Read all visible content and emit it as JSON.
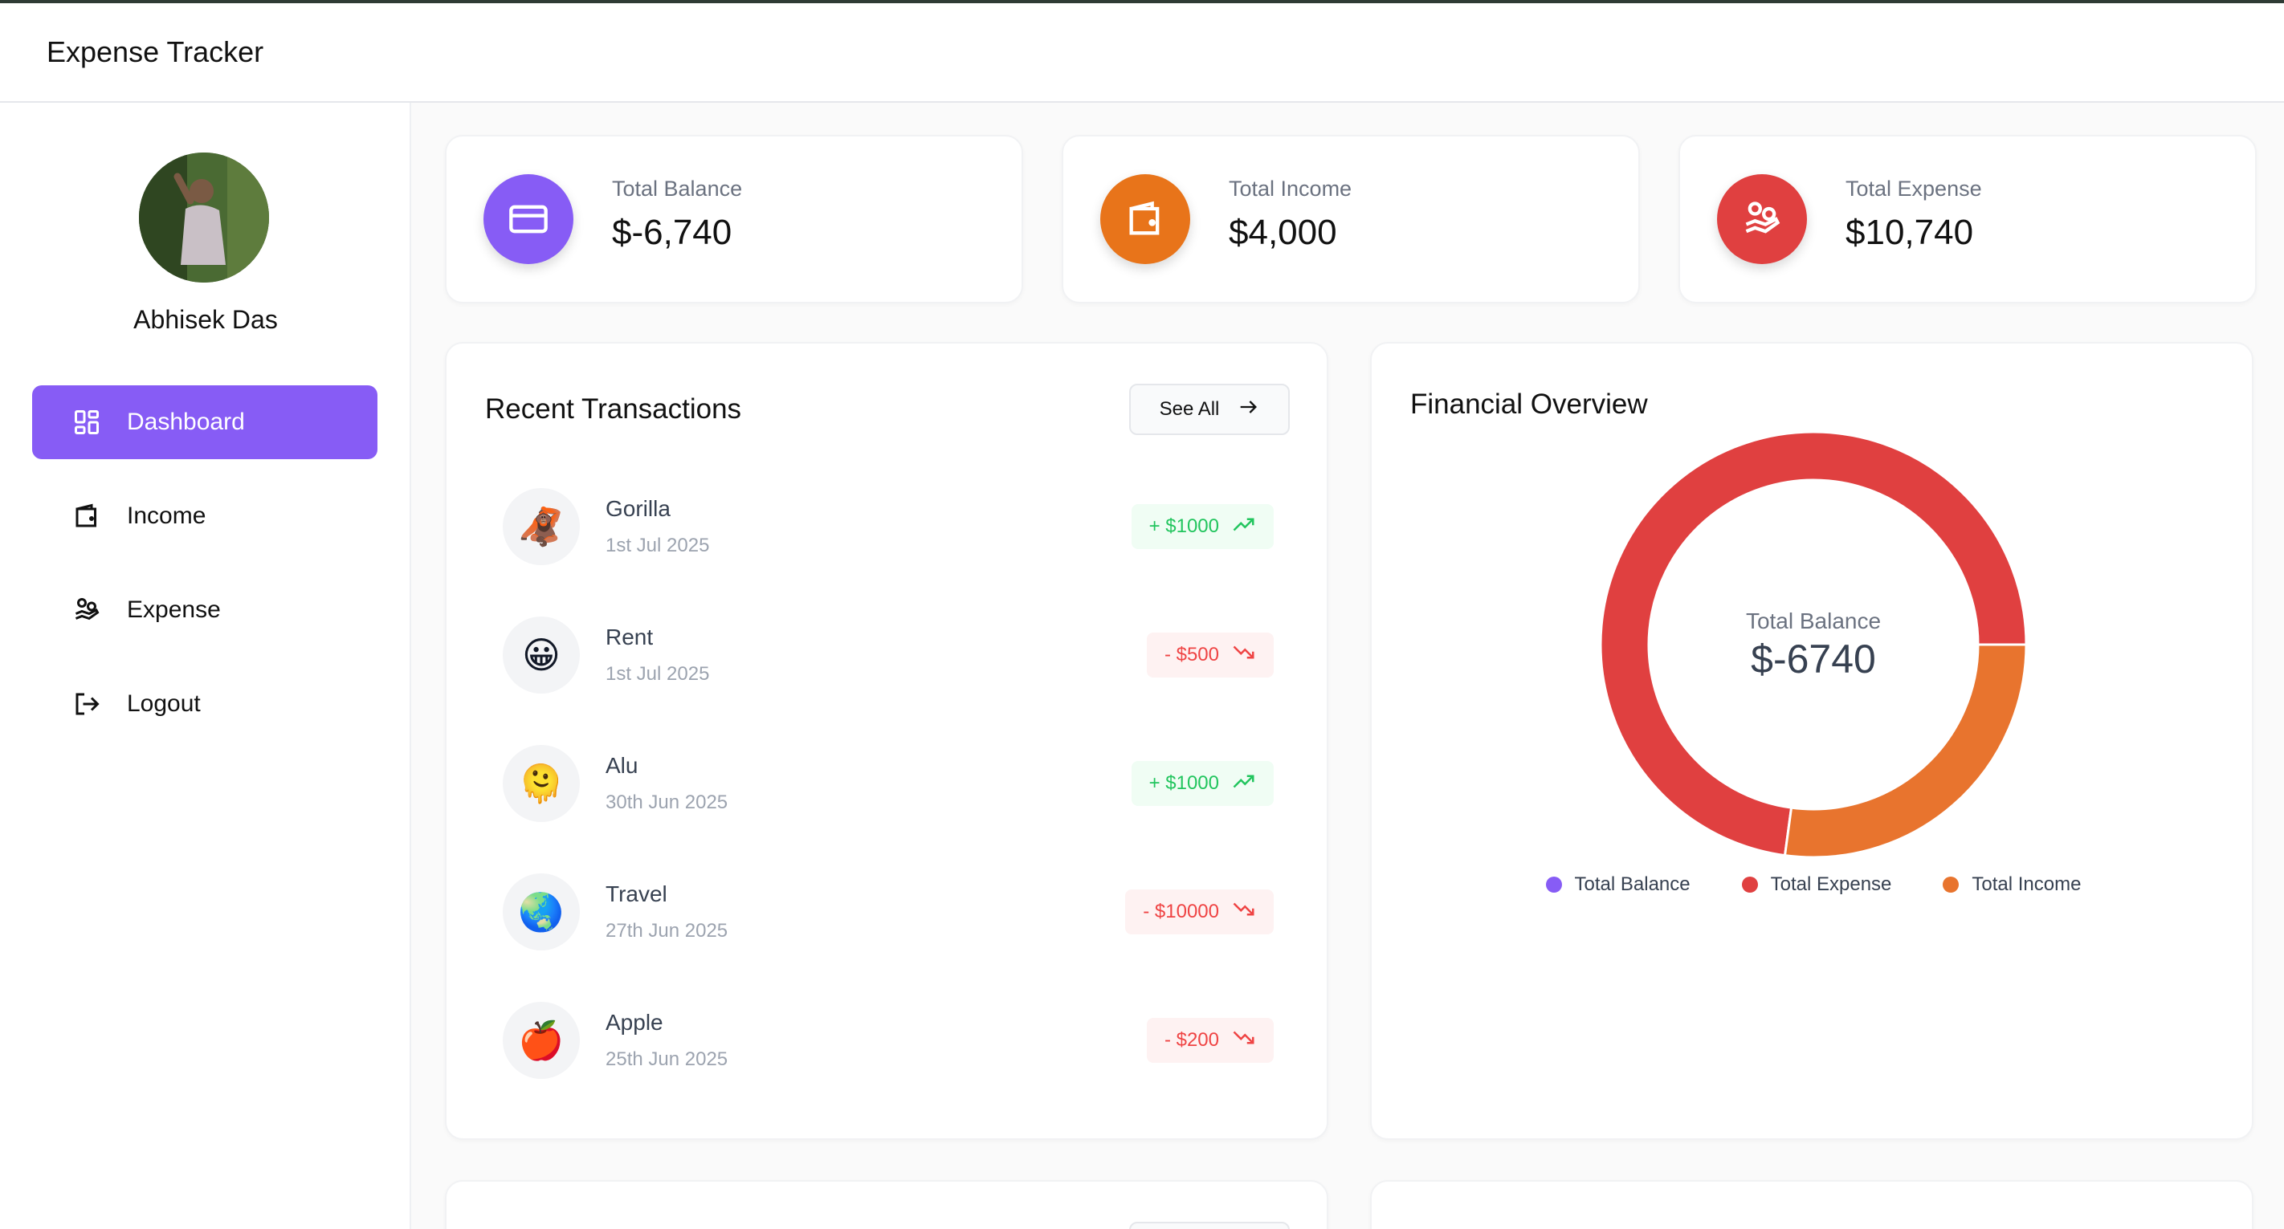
{
  "app": {
    "title": "Expense Tracker"
  },
  "user": {
    "name": "Abhisek Das"
  },
  "sidebar": {
    "items": [
      {
        "label": "Dashboard",
        "icon": "dashboard-grid-icon",
        "active": true
      },
      {
        "label": "Income",
        "icon": "wallet-icon",
        "active": false
      },
      {
        "label": "Expense",
        "icon": "hand-coins-icon",
        "active": false
      },
      {
        "label": "Logout",
        "icon": "logout-icon",
        "active": false
      }
    ]
  },
  "stats": [
    {
      "label": "Total Balance",
      "value": "$-6,740",
      "icon": "credit-card-icon",
      "color": "#875cf5"
    },
    {
      "label": "Total Income",
      "value": "$4,000",
      "icon": "wallet-icon",
      "color": "#e8741a"
    },
    {
      "label": "Total Expense",
      "value": "$10,740",
      "icon": "hand-coins-icon",
      "color": "#e04040"
    }
  ],
  "transactions": {
    "title": "Recent Transactions",
    "see_all_label": "See All",
    "items": [
      {
        "name": "Gorilla",
        "date": "1st Jul 2025",
        "amount": "+ $1000",
        "type": "income",
        "emoji": "🦧"
      },
      {
        "name": "Rent",
        "date": "1st Jul 2025",
        "amount": "- $500",
        "type": "expense",
        "emoji": "😀"
      },
      {
        "name": "Alu",
        "date": "30th Jun 2025",
        "amount": "+ $1000",
        "type": "income",
        "emoji": "🫠"
      },
      {
        "name": "Travel",
        "date": "27th Jun 2025",
        "amount": "- $10000",
        "type": "expense",
        "emoji": "🌏"
      },
      {
        "name": "Apple",
        "date": "25th Jun 2025",
        "amount": "- $200",
        "type": "expense",
        "emoji": "🍎"
      }
    ]
  },
  "overview": {
    "title": "Financial Overview",
    "center_label": "Total Balance",
    "center_value": "$-6740"
  },
  "chart_data": {
    "type": "pie",
    "categories": [
      "Total Balance",
      "Total Expense",
      "Total Income"
    ],
    "values": [
      -6740,
      10740,
      4000
    ],
    "colors": [
      "#875cf5",
      "#e04040",
      "#e8742e"
    ],
    "legend": "bottom"
  }
}
